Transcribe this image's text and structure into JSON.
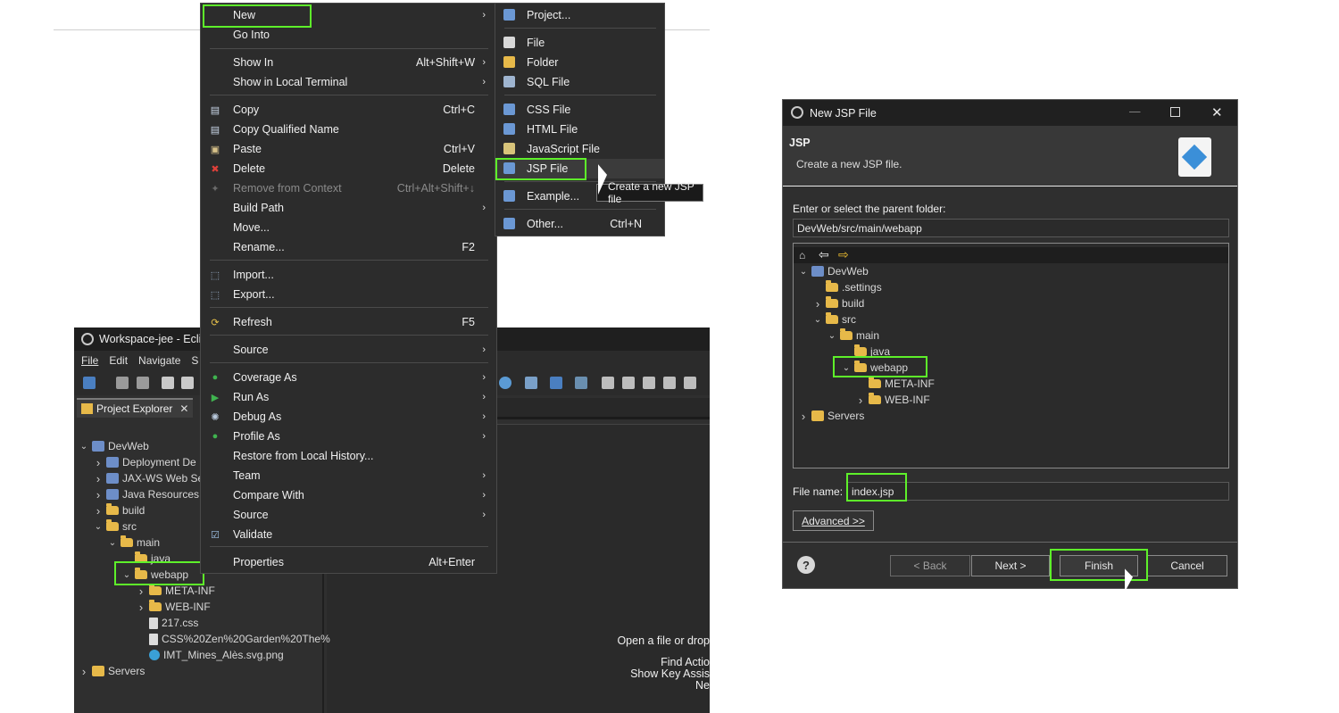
{
  "context_menu": {
    "items": [
      {
        "label": "New",
        "shortcut": "",
        "submenu": true,
        "icon": "none"
      },
      {
        "label": "Go Into",
        "shortcut": "",
        "submenu": false,
        "icon": "none"
      },
      {
        "label": "Show In",
        "shortcut": "Alt+Shift+W",
        "submenu": true,
        "icon": "none"
      },
      {
        "label": "Show in Local Terminal",
        "shortcut": "",
        "submenu": true,
        "icon": "none"
      },
      {
        "label": "Copy",
        "shortcut": "Ctrl+C",
        "submenu": false,
        "icon": "copy-icon"
      },
      {
        "label": "Copy Qualified Name",
        "shortcut": "",
        "submenu": false,
        "icon": "copy-qualified-icon"
      },
      {
        "label": "Paste",
        "shortcut": "Ctrl+V",
        "submenu": false,
        "icon": "paste-icon"
      },
      {
        "label": "Delete",
        "shortcut": "Delete",
        "submenu": false,
        "icon": "delete-icon"
      },
      {
        "label": "Remove from Context",
        "shortcut": "Ctrl+Alt+Shift+↓",
        "submenu": false,
        "icon": "remove-context-icon",
        "disabled": true
      },
      {
        "label": "Build Path",
        "shortcut": "",
        "submenu": true,
        "icon": "none"
      },
      {
        "label": "Move...",
        "shortcut": "",
        "submenu": false,
        "icon": "none"
      },
      {
        "label": "Rename...",
        "shortcut": "F2",
        "submenu": false,
        "icon": "none"
      },
      {
        "label": "Import...",
        "shortcut": "",
        "submenu": false,
        "icon": "import-icon"
      },
      {
        "label": "Export...",
        "shortcut": "",
        "submenu": false,
        "icon": "export-icon"
      },
      {
        "label": "Refresh",
        "shortcut": "F5",
        "submenu": false,
        "icon": "refresh-icon"
      },
      {
        "label": "Source",
        "shortcut": "",
        "submenu": true,
        "icon": "none"
      },
      {
        "label": "Coverage As",
        "shortcut": "",
        "submenu": true,
        "icon": "coverage-icon"
      },
      {
        "label": "Run As",
        "shortcut": "",
        "submenu": true,
        "icon": "run-icon"
      },
      {
        "label": "Debug As",
        "shortcut": "",
        "submenu": true,
        "icon": "debug-icon"
      },
      {
        "label": "Profile As",
        "shortcut": "",
        "submenu": true,
        "icon": "profile-icon"
      },
      {
        "label": "Restore from Local History...",
        "shortcut": "",
        "submenu": false,
        "icon": "none"
      },
      {
        "label": "Team",
        "shortcut": "",
        "submenu": true,
        "icon": "none"
      },
      {
        "label": "Compare With",
        "shortcut": "",
        "submenu": true,
        "icon": "none"
      },
      {
        "label": "Source",
        "shortcut": "",
        "submenu": true,
        "icon": "none"
      },
      {
        "label": "Validate",
        "shortcut": "",
        "submenu": false,
        "icon": "validate-check-icon"
      },
      {
        "label": "Properties",
        "shortcut": "Alt+Enter",
        "submenu": false,
        "icon": "none"
      }
    ]
  },
  "new_submenu": {
    "items": [
      {
        "label": "Project...",
        "shortcut": "",
        "icon": "new-project-icon"
      },
      {
        "label": "File",
        "shortcut": "",
        "icon": "new-file-icon"
      },
      {
        "label": "Folder",
        "shortcut": "",
        "icon": "new-folder-icon"
      },
      {
        "label": "SQL File",
        "shortcut": "",
        "icon": "sql-file-icon"
      },
      {
        "label": "CSS File",
        "shortcut": "",
        "icon": "css-file-icon"
      },
      {
        "label": "HTML File",
        "shortcut": "",
        "icon": "html-file-icon"
      },
      {
        "label": "JavaScript File",
        "shortcut": "",
        "icon": "javascript-file-icon"
      },
      {
        "label": "JSP File",
        "shortcut": "",
        "icon": "jsp-file-icon"
      },
      {
        "label": "Example...",
        "shortcut": "",
        "icon": "example-icon"
      },
      {
        "label": "Other...",
        "shortcut": "Ctrl+N",
        "icon": "other-icon"
      }
    ],
    "tooltip": "Create a new JSP file"
  },
  "eclipse": {
    "title": "Workspace-jee - Eclip",
    "menu": [
      "File",
      "Edit",
      "Navigate",
      "S"
    ],
    "view_tab": "Project Explorer",
    "tree": [
      {
        "label": "DevWeb",
        "indent": 0,
        "chevron": "down",
        "icon": "project"
      },
      {
        "label": "Deployment De",
        "indent": 1,
        "chevron": "right",
        "icon": "deploy"
      },
      {
        "label": "JAX-WS Web Se",
        "indent": 1,
        "chevron": "right",
        "icon": "webservice"
      },
      {
        "label": "Java Resources",
        "indent": 1,
        "chevron": "right",
        "icon": "javares"
      },
      {
        "label": "build",
        "indent": 1,
        "chevron": "right",
        "icon": "folder"
      },
      {
        "label": "src",
        "indent": 1,
        "chevron": "down",
        "icon": "folder"
      },
      {
        "label": "main",
        "indent": 2,
        "chevron": "down",
        "icon": "folder"
      },
      {
        "label": "java",
        "indent": 3,
        "chevron": "",
        "icon": "folder"
      },
      {
        "label": "webapp",
        "indent": 3,
        "chevron": "down",
        "icon": "folder"
      },
      {
        "label": "META-INF",
        "indent": 4,
        "chevron": "right",
        "icon": "folder"
      },
      {
        "label": "WEB-INF",
        "indent": 4,
        "chevron": "right",
        "icon": "folder"
      },
      {
        "label": "217.css",
        "indent": 4,
        "chevron": "",
        "icon": "file"
      },
      {
        "label": "CSS%20Zen%20Garden%20The%",
        "indent": 4,
        "chevron": "",
        "icon": "file"
      },
      {
        "label": "IMT_Mines_Alès.svg.png",
        "indent": 4,
        "chevron": "",
        "icon": "image"
      },
      {
        "label": "Servers",
        "indent": 0,
        "chevron": "right",
        "icon": "servers"
      }
    ],
    "editor_hints": [
      "Open a file or drop",
      "Find Actio",
      "Show Key Assis",
      "Ne"
    ]
  },
  "dialog": {
    "title": "New JSP File",
    "banner_title": "JSP",
    "banner_desc": "Create a new JSP file.",
    "parent_label": "Enter or select the parent folder:",
    "parent_value": "DevWeb/src/main/webapp",
    "tree": [
      {
        "label": "DevWeb",
        "indent": 0,
        "chevron": "down",
        "icon": "project"
      },
      {
        "label": ".settings",
        "indent": 1,
        "chevron": "",
        "icon": "folder"
      },
      {
        "label": "build",
        "indent": 1,
        "chevron": "right",
        "icon": "folder"
      },
      {
        "label": "src",
        "indent": 1,
        "chevron": "down",
        "icon": "folder"
      },
      {
        "label": "main",
        "indent": 2,
        "chevron": "down",
        "icon": "folder"
      },
      {
        "label": "java",
        "indent": 3,
        "chevron": "",
        "icon": "folder"
      },
      {
        "label": "webapp",
        "indent": 3,
        "chevron": "down",
        "icon": "folder"
      },
      {
        "label": "META-INF",
        "indent": 4,
        "chevron": "",
        "icon": "folder"
      },
      {
        "label": "WEB-INF",
        "indent": 4,
        "chevron": "right",
        "icon": "folder"
      },
      {
        "label": "Servers",
        "indent": 0,
        "chevron": "right",
        "icon": "servers"
      }
    ],
    "file_label": "File name:",
    "file_value": "index.jsp",
    "advanced": "Advanced >>",
    "back": "< Back",
    "next": "Next >",
    "finish": "Finish",
    "cancel": "Cancel"
  }
}
